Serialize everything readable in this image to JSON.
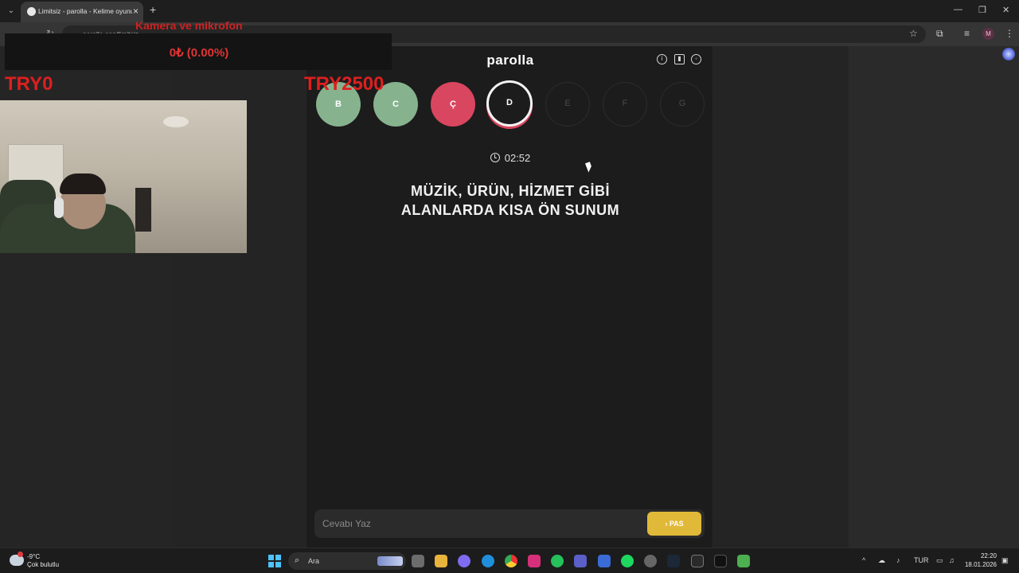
{
  "browser": {
    "tab_title": "Limitsiz - parolla - Kelime oyunu",
    "url": "parolla.app/limitsiz"
  },
  "game": {
    "title": "parolla",
    "letters": [
      {
        "letter": "B",
        "state": "correct"
      },
      {
        "letter": "C",
        "state": "correct"
      },
      {
        "letter": "Ç",
        "state": "wrong"
      },
      {
        "letter": "D",
        "state": "active"
      },
      {
        "letter": "E",
        "state": "pending"
      },
      {
        "letter": "F",
        "state": "pending"
      },
      {
        "letter": "G",
        "state": "pending"
      }
    ],
    "timer": "02:52",
    "question_line1": "MÜZİK, ÜRÜN, HİZMET GİBİ",
    "question_line2": "ALANLARDA KISA ÖN SUNUM",
    "answer_placeholder": "Cevabı Yaz",
    "pass_label": "PAS",
    "colors": {
      "correct": "#86b38e",
      "wrong": "#d9465f",
      "pass": "#e1b938"
    }
  },
  "overlay": {
    "camera_label": "Kamera ve mikrofon",
    "percent_text": "0₺ (0.00%)",
    "try_left": "TRY0",
    "try_right": "TRY2500"
  },
  "taskbar": {
    "weather_temp": "-9°C",
    "weather_desc": "Çok bulutlu",
    "search_placeholder": "Ara",
    "language": "TUR",
    "time": "22:20",
    "date": "18.01.2026"
  }
}
